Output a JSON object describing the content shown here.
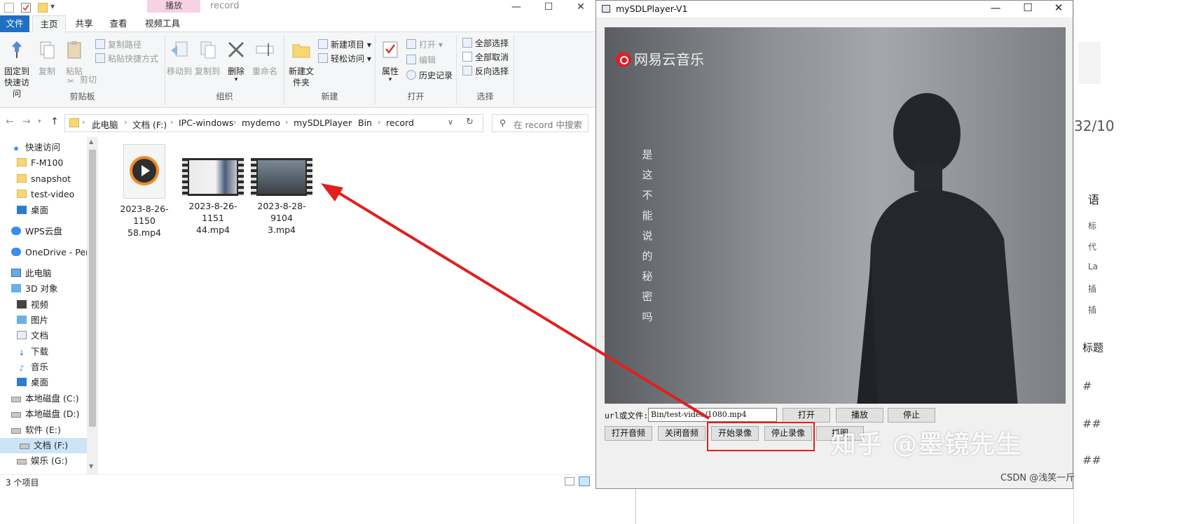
{
  "explorer": {
    "title": "record",
    "contextual_tab": "播放",
    "window_controls": {
      "minimize": "—",
      "maximize": "☐",
      "close": "✕"
    },
    "tabs": [
      "文件",
      "主页",
      "共享",
      "查看",
      "视频工具"
    ],
    "ribbon": {
      "clipboard": {
        "label": "剪贴板",
        "pin": "固定到快速访问",
        "copy": "复制",
        "paste": "粘贴",
        "copy_path": "复制路径",
        "paste_shortcut": "粘贴快捷方式",
        "cut": "剪切"
      },
      "organize": {
        "label": "组织",
        "move_to": "移动到",
        "copy_to": "复制到",
        "delete": "删除",
        "rename": "重命名"
      },
      "new": {
        "label": "新建",
        "new_folder": "新建文件夹",
        "new_item": "新建项目",
        "easy_access": "轻松访问"
      },
      "open": {
        "label": "打开",
        "properties": "属性",
        "open": "打开",
        "edit": "编辑",
        "history": "历史记录"
      },
      "select": {
        "label": "选择",
        "select_all": "全部选择",
        "select_none": "全部取消",
        "invert": "反向选择"
      }
    },
    "breadcrumb": [
      "此电脑",
      "文档 (F:)",
      "IPC-windows",
      "mydemo",
      "mySDLPlayer",
      "Bin",
      "record"
    ],
    "search_placeholder": "在 record 中搜索",
    "sidebar": [
      {
        "label": "快速访问",
        "icon": "star-icon"
      },
      {
        "label": "F-M100",
        "icon": "folder-icon"
      },
      {
        "label": "snapshot",
        "icon": "folder-icon"
      },
      {
        "label": "test-video",
        "icon": "folder-icon"
      },
      {
        "label": "桌面",
        "icon": "desktop-icon"
      },
      {
        "label": "WPS云盘",
        "icon": "cloud-icon"
      },
      {
        "label": "OneDrive - Perso",
        "icon": "cloud-icon"
      },
      {
        "label": "此电脑",
        "icon": "computer-icon"
      },
      {
        "label": "3D 对象",
        "icon": "cube-icon"
      },
      {
        "label": "视频",
        "icon": "video-icon"
      },
      {
        "label": "图片",
        "icon": "picture-icon"
      },
      {
        "label": "文档",
        "icon": "document-icon"
      },
      {
        "label": "下载",
        "icon": "download-icon"
      },
      {
        "label": "音乐",
        "icon": "music-icon"
      },
      {
        "label": "桌面",
        "icon": "desktop-icon"
      },
      {
        "label": "本地磁盘 (C:)",
        "icon": "drive-icon"
      },
      {
        "label": "本地磁盘 (D:)",
        "icon": "drive-icon"
      },
      {
        "label": "软件 (E:)",
        "icon": "drive-icon"
      },
      {
        "label": "文档 (F:)",
        "icon": "drive-icon"
      },
      {
        "label": "娱乐 (G:)",
        "icon": "drive-icon"
      }
    ],
    "files": [
      {
        "line1": "2023-8-26-1150",
        "line2": "58.mp4"
      },
      {
        "line1": "2023-8-26-1151",
        "line2": "44.mp4"
      },
      {
        "line1": "2023-8-28-9104",
        "line2": "3.mp4"
      }
    ],
    "status": "3 个项目"
  },
  "player": {
    "title": "mySDLPlayer-V1",
    "logo_text": "网易云音乐",
    "lyrics": "是这不能说的秘密吗",
    "url_label": "url或文件:",
    "url_value": "Bin/test-video/1080.mp4",
    "buttons": {
      "open": "打开",
      "play": "播放",
      "stop": "停止",
      "open_audio": "打开音频",
      "close_audio": "关闭音频",
      "start_record": "开始录像",
      "stop_record": "停止录像",
      "snapshot": "抓图"
    }
  },
  "background_page": {
    "items": [
      "32/10",
      "语",
      "标",
      "代",
      "La",
      "插",
      "插",
      "标题",
      "#",
      "##",
      "##"
    ]
  },
  "watermark": "知乎 @墨镜先生",
  "csdn": "CSDN @浅笑一斤",
  "colors": {
    "file_tab": "#1f6fc5",
    "contextual_tab": "#f6d2e3",
    "highlight": "#e0201f",
    "selection": "#cce4f7"
  }
}
